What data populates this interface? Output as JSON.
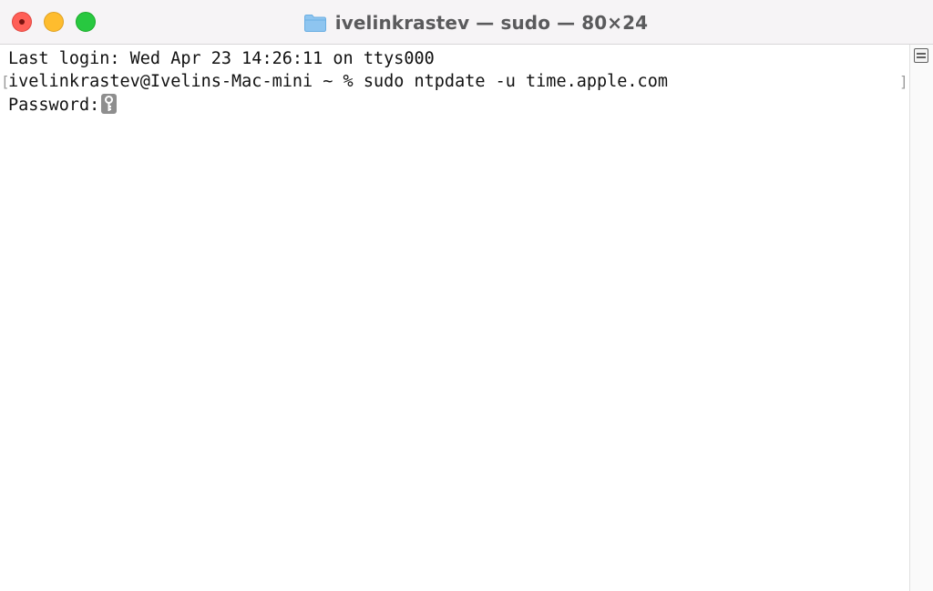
{
  "window": {
    "title": "ivelinkrastev — sudo — 80×24"
  },
  "icons": {
    "title_icon": "folder-icon",
    "cursor_icon": "key-icon",
    "scroll_control_icon": "split-pane-icon"
  },
  "colors": {
    "close": "#ff5f57",
    "minimize": "#febc2e",
    "zoom": "#28c840",
    "folder": "#8ec5f0"
  },
  "terminal": {
    "lines": [
      "Last login: Wed Apr 23 14:26:11 on ttys000",
      "ivelinkrastev@Ivelins-Mac-mini ~ % sudo ntpdate -u time.apple.com",
      "Password:"
    ],
    "prompt_mark_left": "[",
    "prompt_mark_right": "]"
  }
}
